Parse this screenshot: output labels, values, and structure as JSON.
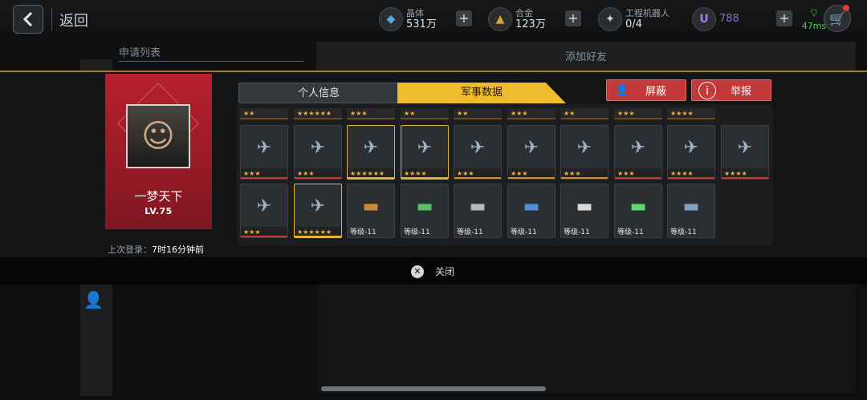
{
  "topbar": {
    "back_label": "返回",
    "crystal": {
      "label": "晶体",
      "value": "531万"
    },
    "alloy": {
      "label": "合金",
      "value": "123万"
    },
    "robot": {
      "label": "工程机器人",
      "value": "0/4"
    },
    "premium": {
      "value": "788"
    },
    "ping": "47ms"
  },
  "background": {
    "apply_list": "申请列表",
    "add_friend": "添加好友"
  },
  "profile": {
    "name": "一梦天下",
    "level": "LV.75",
    "last_login_label": "上次登录：",
    "last_login_value": "7时16分钟前"
  },
  "tabs": {
    "info": "个人信息",
    "military": "军事数据"
  },
  "actions": {
    "block": "屏蔽",
    "report": "举报"
  },
  "top_strip": [
    "★★",
    "★★★★★★",
    "★★★",
    "★★",
    "★★",
    "★★★",
    "★★",
    "★★★",
    "★★★★"
  ],
  "row1": [
    {
      "stars": "★★★",
      "icon": "ship-icon",
      "gold": false,
      "bar": "red"
    },
    {
      "stars": "★★★",
      "icon": "ship-icon",
      "gold": false,
      "bar": "red"
    },
    {
      "stars": "★★★★★★",
      "icon": "ship-icon",
      "gold": true,
      "bar": "goldb"
    },
    {
      "stars": "★★★★",
      "icon": "ship-icon",
      "gold": true,
      "bar": "goldb"
    },
    {
      "stars": "★★★",
      "icon": "ship-icon",
      "gold": false,
      "bar": "orange"
    },
    {
      "stars": "★★★",
      "icon": "ship-icon",
      "gold": false,
      "bar": "orange"
    },
    {
      "stars": "★★★",
      "icon": "ship-icon",
      "gold": false,
      "bar": "orange"
    },
    {
      "stars": "★★★",
      "icon": "ship-icon",
      "gold": false,
      "bar": "red"
    },
    {
      "stars": "★★★★",
      "icon": "ship-icon",
      "gold": false,
      "bar": "red"
    },
    {
      "stars": "★★★★",
      "icon": "ship-icon",
      "gold": false,
      "bar": "red"
    }
  ],
  "row2_ships": [
    {
      "stars": "★★★",
      "gold": false,
      "bar": "red"
    },
    {
      "stars": "★★★★★★",
      "gold": true,
      "bar": "goldb"
    }
  ],
  "row2_parts": [
    "等级-11",
    "等级-11",
    "等级-11",
    "等级-11",
    "等级-11",
    "等级-11",
    "等级-11"
  ],
  "close_label": "关闭"
}
